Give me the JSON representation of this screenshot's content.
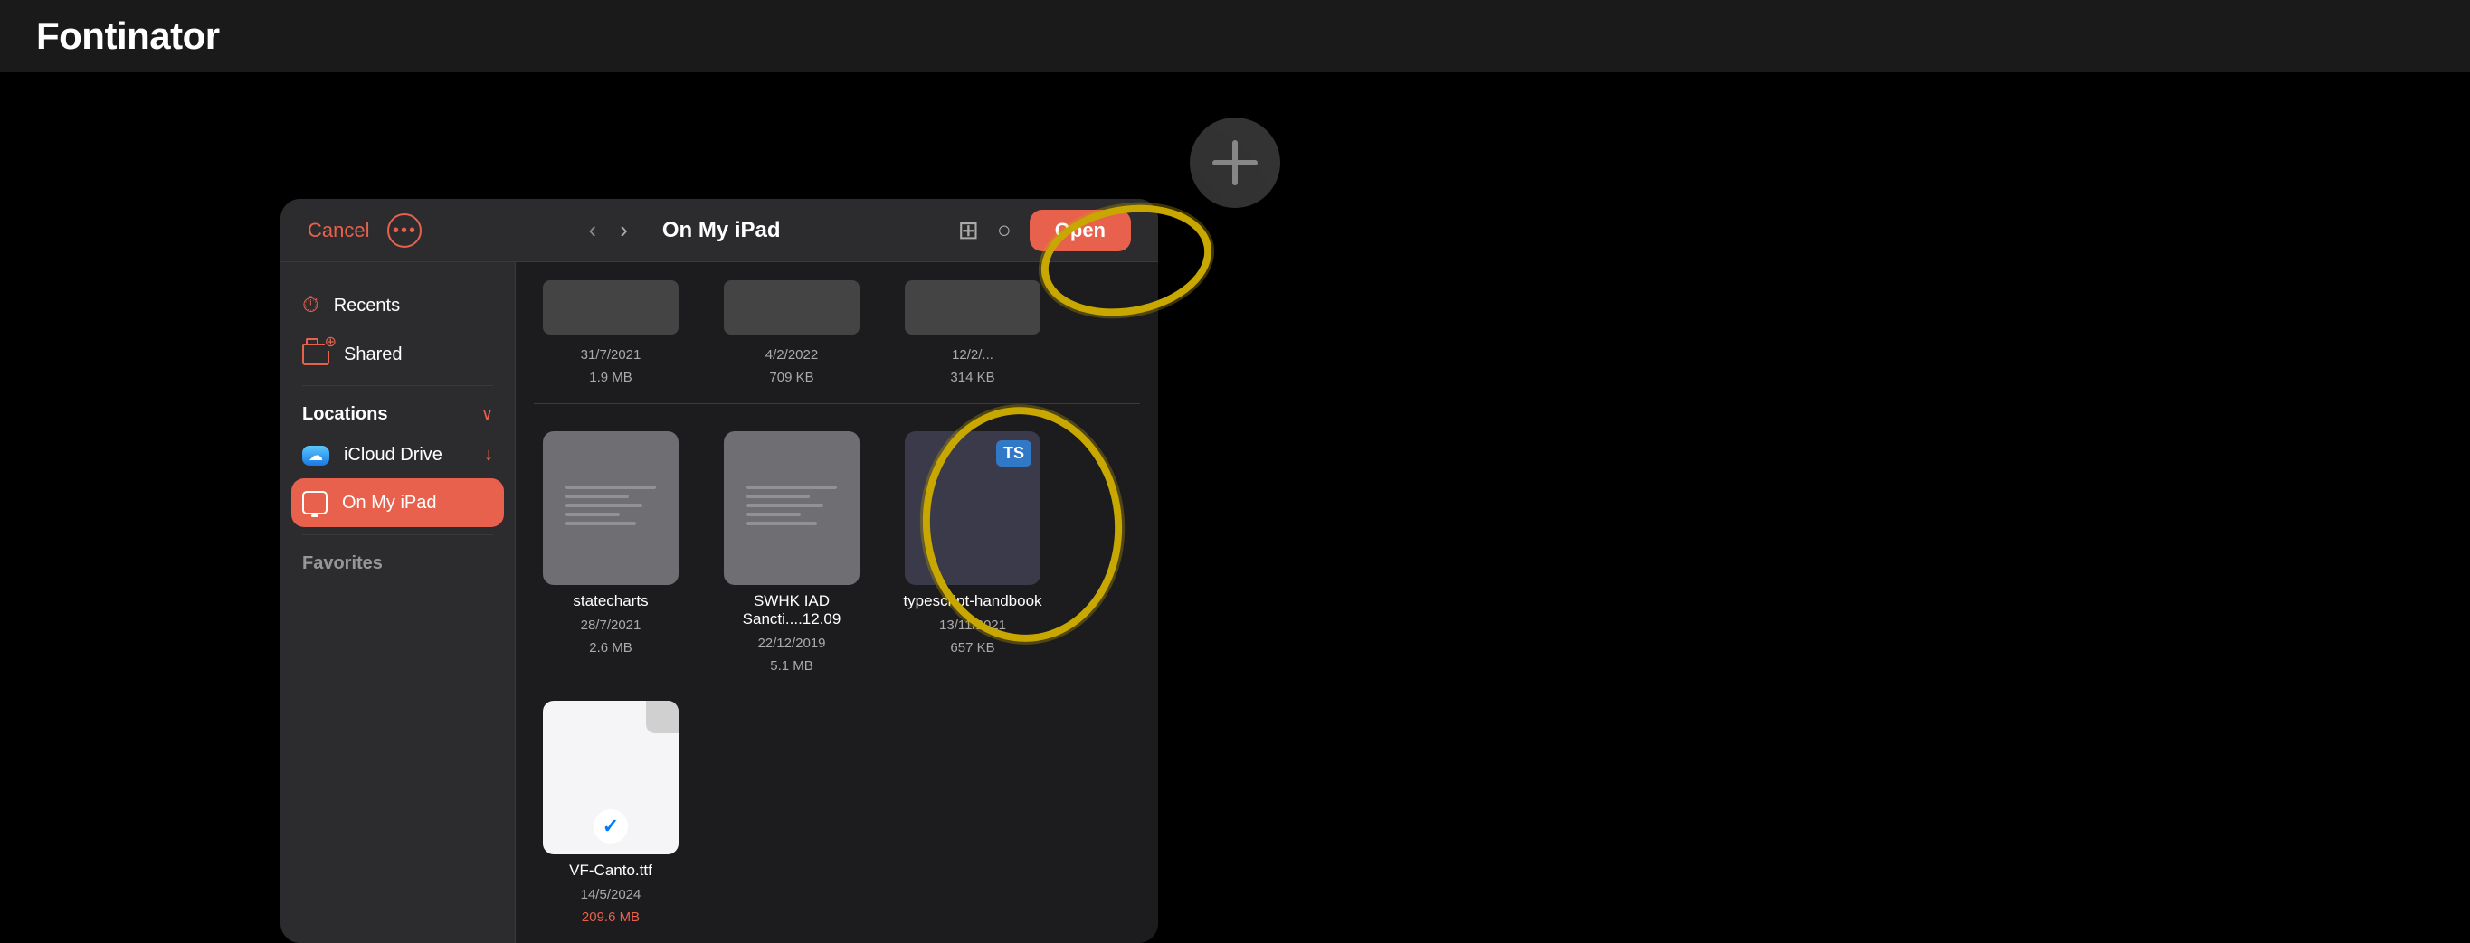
{
  "app": {
    "title": "Fontinator"
  },
  "dialog": {
    "cancel_label": "Cancel",
    "more_label": "...",
    "location": "On My iPad",
    "open_label": "Open"
  },
  "sidebar": {
    "items": [
      {
        "id": "recents",
        "label": "Recents",
        "icon": "clock"
      },
      {
        "id": "shared",
        "label": "Shared",
        "icon": "shared-folder"
      }
    ],
    "locations_section": {
      "title": "Locations",
      "items": [
        {
          "id": "icloud",
          "label": "iCloud Drive",
          "icon": "icloud",
          "has_sync": true
        },
        {
          "id": "ipad",
          "label": "On My iPad",
          "icon": "ipad",
          "active": true
        }
      ]
    },
    "favorites_label": "Favorites"
  },
  "files": {
    "top_row": [
      {
        "date": "31/7/2021",
        "size": "1.9 MB"
      },
      {
        "date": "4/2/2022",
        "size": "709 KB"
      },
      {
        "date": "12/2/...",
        "size": "314 KB"
      }
    ],
    "main_row": [
      {
        "name": "statecharts",
        "date": "28/7/2021",
        "size": "2.6 MB",
        "type": "doc-gray",
        "selected": false
      },
      {
        "name": "SWHK IAD Sancti....12.09",
        "date": "22/12/2019",
        "size": "5.1 MB",
        "type": "doc-gray",
        "selected": false
      },
      {
        "name": "typescript-handbook",
        "date": "13/11/2021",
        "size": "657 KB",
        "type": "ts-dark",
        "selected": false
      },
      {
        "name": "VF-Canto.ttf",
        "date": "14/5/2024",
        "size": "209.6 MB",
        "type": "ttf",
        "selected": true
      }
    ]
  },
  "colors": {
    "accent": "#e8614d",
    "annotation": "#c8a800",
    "blue": "#007aff"
  }
}
